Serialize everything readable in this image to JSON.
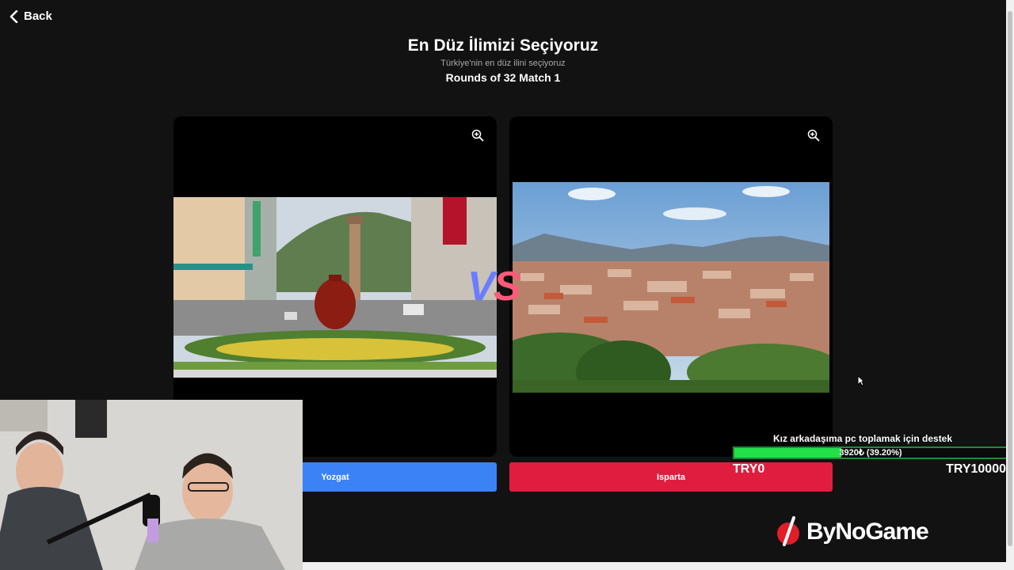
{
  "nav": {
    "back_label": "Back"
  },
  "header": {
    "title": "En Düz İlimizi Seçiyoruz",
    "subtitle": "Türkiye'nin en düz ilini seçiyoruz",
    "round": "Rounds of 32 Match 1"
  },
  "match": {
    "vs_v": "V",
    "vs_s": "S",
    "left": {
      "name": "Yozgat",
      "color": "#3b82f6"
    },
    "right": {
      "name": "Isparta",
      "color": "#e11d3f"
    }
  },
  "donation": {
    "title": "Kız arkadaşıma pc toplamak için destek",
    "progress_label": "3920₺ (39.20%)",
    "progress_fraction": 0.392,
    "min_label": "TRY0",
    "max_label": "TRY10000"
  },
  "brand": {
    "name": "ByNoGame"
  }
}
